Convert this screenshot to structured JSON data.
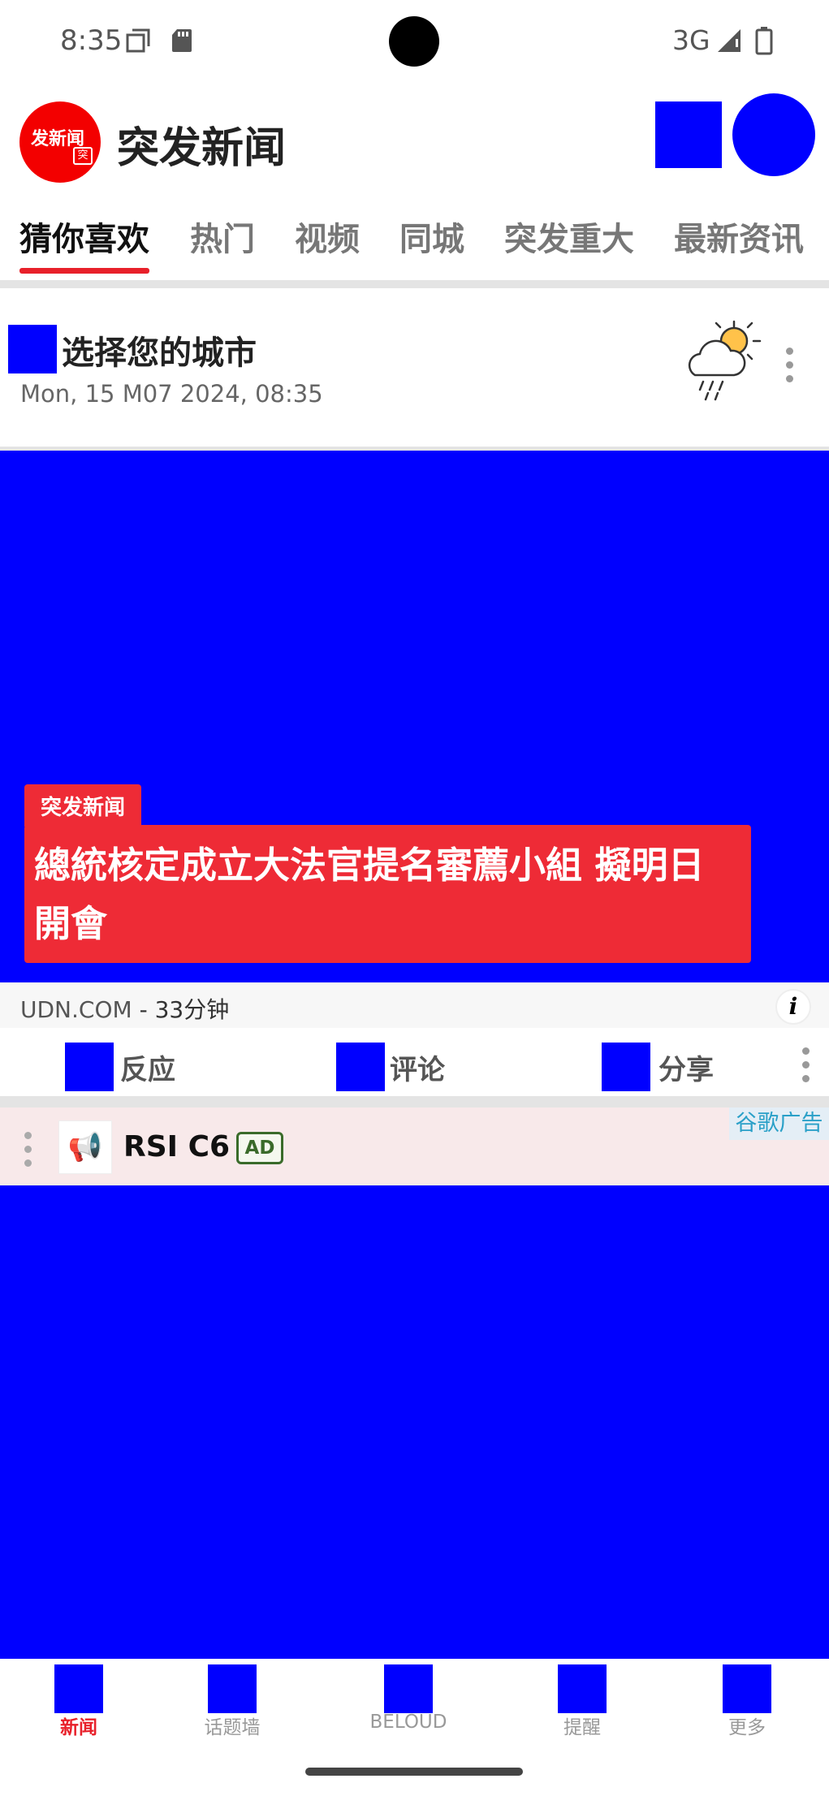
{
  "status_bar": {
    "time": "8:35",
    "network": "3G",
    "icons": [
      "screenshot-icon",
      "sd-card-icon",
      "signal-icon",
      "battery-icon"
    ]
  },
  "header": {
    "logo_text": "发新闻",
    "logo_badge": "突",
    "app_title": "突发新闻"
  },
  "tabs": [
    {
      "label": "猜你喜欢",
      "active": true
    },
    {
      "label": "热门",
      "active": false
    },
    {
      "label": "视频",
      "active": false
    },
    {
      "label": "同城",
      "active": false
    },
    {
      "label": "突发重大",
      "active": false
    },
    {
      "label": "最新资讯",
      "active": false
    }
  ],
  "weather": {
    "city_prompt": "选择您的城市",
    "datetime": "Mon, 15 M07 2024, 08:35",
    "icon": "partly-cloudy-rain-icon"
  },
  "feature": {
    "tag": "突发新闻",
    "headline": "總統核定成立大法官提名審薦小組 擬明日開會",
    "source": "UDN.COM",
    "time_ago": "- 33分钟"
  },
  "actions": {
    "react": "反应",
    "comment": "评论",
    "share": "分享"
  },
  "ad": {
    "label": "谷歌广告",
    "name": "RSI C6",
    "badge": "AD"
  },
  "bottom_nav": [
    {
      "label": "新闻",
      "active": true
    },
    {
      "label": "话题墙",
      "active": false
    },
    {
      "label": "BELOUD",
      "active": false
    },
    {
      "label": "提醒",
      "active": false
    },
    {
      "label": "更多",
      "active": false
    }
  ],
  "colors": {
    "accent": "#e8202a",
    "placeholder": "#0000ff",
    "headline_bg": "#ee2b36",
    "ad_bg": "#f8e9ea"
  }
}
